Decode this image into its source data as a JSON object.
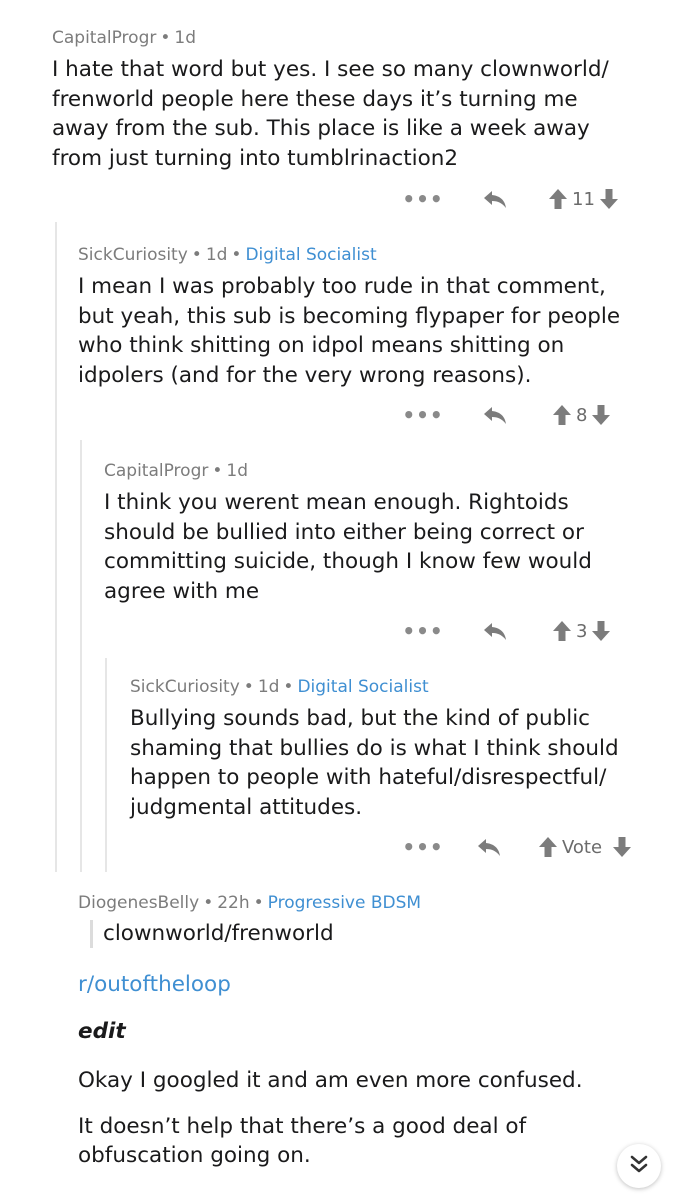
{
  "comments": [
    {
      "author": "CapitalProgr",
      "age": "1d",
      "flair": "",
      "lines": [
        "I hate that word but yes. I see so many clownworld/",
        "frenworld people here these days it’s turning me",
        "away from the sub. This place is like a week away",
        "from just turning into tumblrinaction2"
      ],
      "score": "11"
    },
    {
      "author": "SickCuriosity",
      "age": "1d",
      "flair": "Digital Socialist",
      "lines": [
        "I mean I was probably too rude in that comment,",
        "but yeah, this sub is becoming flypaper for people",
        "who think shitting on idpol means shitting on",
        "idpolers (and for the very wrong reasons)."
      ],
      "score": "8"
    },
    {
      "author": "CapitalProgr",
      "age": "1d",
      "flair": "",
      "lines": [
        "I think you werent mean enough. Rightoids",
        "should be bullied into either being correct or",
        "committing suicide, though I know few would",
        "agree with me"
      ],
      "score": "3"
    },
    {
      "author": "SickCuriosity",
      "age": "1d",
      "flair": "Digital Socialist",
      "lines": [
        "Bullying sounds bad, but the kind of public",
        "shaming that bullies do is what I think should",
        "happen to people with hateful/disrespectful/",
        "judgmental attitudes."
      ],
      "score": "Vote"
    },
    {
      "author": "DiogenesBelly",
      "age": "22h",
      "flair": "Progressive BDSM",
      "quote": "clownworld/frenworld",
      "link": "r/outoftheloop",
      "edit": "edit",
      "para1": "Okay I googled it and am even more confused.",
      "para2_lines": [
        "It doesn’t help that there’s a good deal of",
        "obfuscation going on."
      ]
    }
  ],
  "icons": {
    "more": "more-options-icon",
    "reply": "reply-icon",
    "upvote": "upvote-icon",
    "downvote": "downvote-icon",
    "collapse": "double-chevron-down-icon"
  },
  "colors": {
    "flair": "#3f8fd2",
    "meta": "#7c7c7c",
    "text": "#1a1a1b"
  },
  "more_glyph": "•••"
}
